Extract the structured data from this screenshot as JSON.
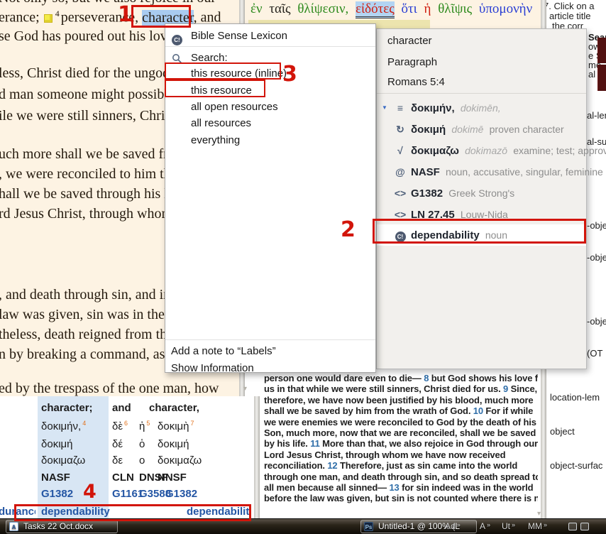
{
  "colors": {
    "annotation_red": "#d2150a",
    "cream_background": "#fdf3e3",
    "selection_blue": "#a9cbf0",
    "flyout_background": "#f2f0ed",
    "link_blue": "#2456a4",
    "icon_slate": "#4e5f79",
    "orange_footnote_number": "#e2731e",
    "greek_green": "#2f8b1f",
    "greek_red": "#d01f10",
    "greek_blue": "#2a3fd4",
    "maroon_block": "#521111"
  },
  "annotations": {
    "marker1": "1",
    "marker2": "2",
    "marker3": "3",
    "marker4": "4"
  },
  "left_pane": {
    "lines": [
      "Not only so, but we also rejoice in our",
      "se God has poured out his love",
      "less, Christ died for the ungod",
      "d man someone might possibl",
      "ile we were still sinners, Chris",
      "uch more shall we be saved fro",
      ", we were reconciled to him thr",
      "hall we be saved through his li",
      "rd Jesus Christ, through whom",
      ", and death through sin, and in",
      "law was given, sin was in the w",
      "theless, death reigned from th",
      "n by breaking a command, as di",
      "ed by the trespass of the one man, how"
    ],
    "line1": {
      "pre": "erance;",
      "verse_num": "4",
      "mid": "perseverance, ",
      "highlight_word": "character",
      "post": ", and"
    }
  },
  "greek_pane": {
    "words": [
      "ἐν",
      "ταῖς",
      "θλίψεσιν,",
      "εἰδότες",
      "ὅτι",
      "ἡ",
      "θλῖψις",
      "ὑπομονὴν"
    ]
  },
  "context_menu": {
    "bsl_label": "Bible Sense Lexicon",
    "bsl_icon_text": "C!",
    "search_label": "Search:",
    "targets": [
      "this resource (inline)",
      "this resource",
      "all open resources",
      "all resources",
      "everything"
    ],
    "add_note_label": "Add a note to “Labels”",
    "show_info_label": "Show Information"
  },
  "flyout": {
    "headers": [
      "character",
      "Paragraph",
      "Romans 5:4"
    ],
    "entries": [
      {
        "expander": "▼",
        "glyph": "≡",
        "main": "δοκιμήν,",
        "translit": "dokimēn,",
        "desc": ""
      },
      {
        "glyph": "↻",
        "main": "δοκιμή",
        "translit": "dokimē",
        "desc": "proven character"
      },
      {
        "glyph": "√",
        "main": "δοκιμαζω",
        "translit": "dokimazō",
        "desc": "examine; test; approve"
      },
      {
        "glyph": "@",
        "main": "NASF",
        "desc": "noun, accusative, singular, feminine"
      },
      {
        "glyph": "<>",
        "main": "G1382",
        "desc": "Greek Strong's"
      },
      {
        "glyph": "<>",
        "main": "LN 27.45",
        "desc": "Louw-Nida"
      },
      {
        "glyph": "C!",
        "main": "dependability",
        "desc": "noun"
      }
    ]
  },
  "table": {
    "rows": [
      {
        "c1": {
          "t": "character;"
        },
        "c2": {
          "t": "and"
        },
        "c4": {
          "t": "character,"
        }
      },
      {
        "c1": {
          "t": "δοκιμήν,",
          "n": "4"
        },
        "c2": {
          "t": "δὲ",
          "n": "6"
        },
        "c3": {
          "t": "ἡ",
          "n": "5"
        },
        "c4": {
          "t": "δοκιμὴ",
          "n": "7"
        }
      },
      {
        "c1": {
          "t": "δοκιμή"
        },
        "c2": {
          "t": "δέ"
        },
        "c3": {
          "t": "ὁ"
        },
        "c4": {
          "t": "δοκιμή"
        }
      },
      {
        "c1": {
          "t": "δοκιμαζω"
        },
        "c2": {
          "t": "δε"
        },
        "c3": {
          "t": "ο"
        },
        "c4": {
          "t": "δοκιμαζω"
        }
      },
      {
        "c1": {
          "t": "NASF"
        },
        "c2": {
          "t": "CLN"
        },
        "c3": {
          "t": "DNSF"
        },
        "c4": {
          "t": "NNSF"
        }
      },
      {
        "c1": {
          "t": "G1382"
        },
        "c2": {
          "t": "G1161"
        },
        "c3": {
          "t": "G3588"
        },
        "c4": {
          "t": "G1382"
        }
      },
      {
        "c0": {
          "t": "durance"
        },
        "c1": {
          "t": "dependability"
        },
        "c4": {
          "t": "dependabilit"
        }
      }
    ]
  },
  "esv": {
    "lines": [
      {
        "a": "person one would dare even to die— ",
        "v": "8",
        "b": " but God shows his love for"
      },
      {
        "a": "us in that while we were still sinners, Christ died for us. ",
        "v": "9",
        "b": " Since,"
      },
      {
        "a": "therefore, we have now been justified by his blood, much more"
      },
      {
        "a": "shall we be saved by him from the wrath of God. ",
        "v": "10",
        "b": " For if while"
      },
      {
        "a": "we were enemies we were reconciled to God by the death of his"
      },
      {
        "a": "Son, much more, now that we are reconciled, shall we be saved"
      },
      {
        "a": "by his life. ",
        "v": "11",
        "b": " More than that, we also rejoice in God through our"
      },
      {
        "a": "Lord Jesus Christ, through whom we have now received"
      },
      {
        "a": "reconciliation. ",
        "v": "12",
        "b": " Therefore, just as sin came into the world"
      },
      {
        "a": "through one man, and death through sin, and so death spread to"
      },
      {
        "a": "all men because all sinned— ",
        "v": "13",
        "b": " for sin indeed was in the world"
      },
      {
        "a": "before the law was given, but sin is not counted where there is no"
      }
    ]
  },
  "right_panel": {
    "instructions": [
      "7. Click on a",
      "article title",
      "the corr"
    ],
    "edge_fragments": [
      "Searc",
      "owing",
      "e Sear",
      "me",
      "al",
      "al-lem",
      "al-sur",
      "-obje",
      "-obje",
      "-obje",
      "(OT"
    ],
    "labels": [
      "location-lem",
      "object",
      "object-surfac"
    ]
  },
  "taskbar": {
    "buttons": [
      {
        "label": "Tasks 22 Oct.docx",
        "icon_text": "A"
      },
      {
        "label": "Untitled-1 @ 100% (L",
        "icon_text": "Ps"
      }
    ],
    "toolbars": [
      {
        "label": "Ad",
        "chevron": "»"
      },
      {
        "label": "A",
        "chevron": "»"
      },
      {
        "label": "Ut",
        "chevron": "»"
      },
      {
        "label": "MM",
        "chevron": "»"
      }
    ]
  },
  "misc": {
    "scroll_down_arrow": "▾"
  }
}
